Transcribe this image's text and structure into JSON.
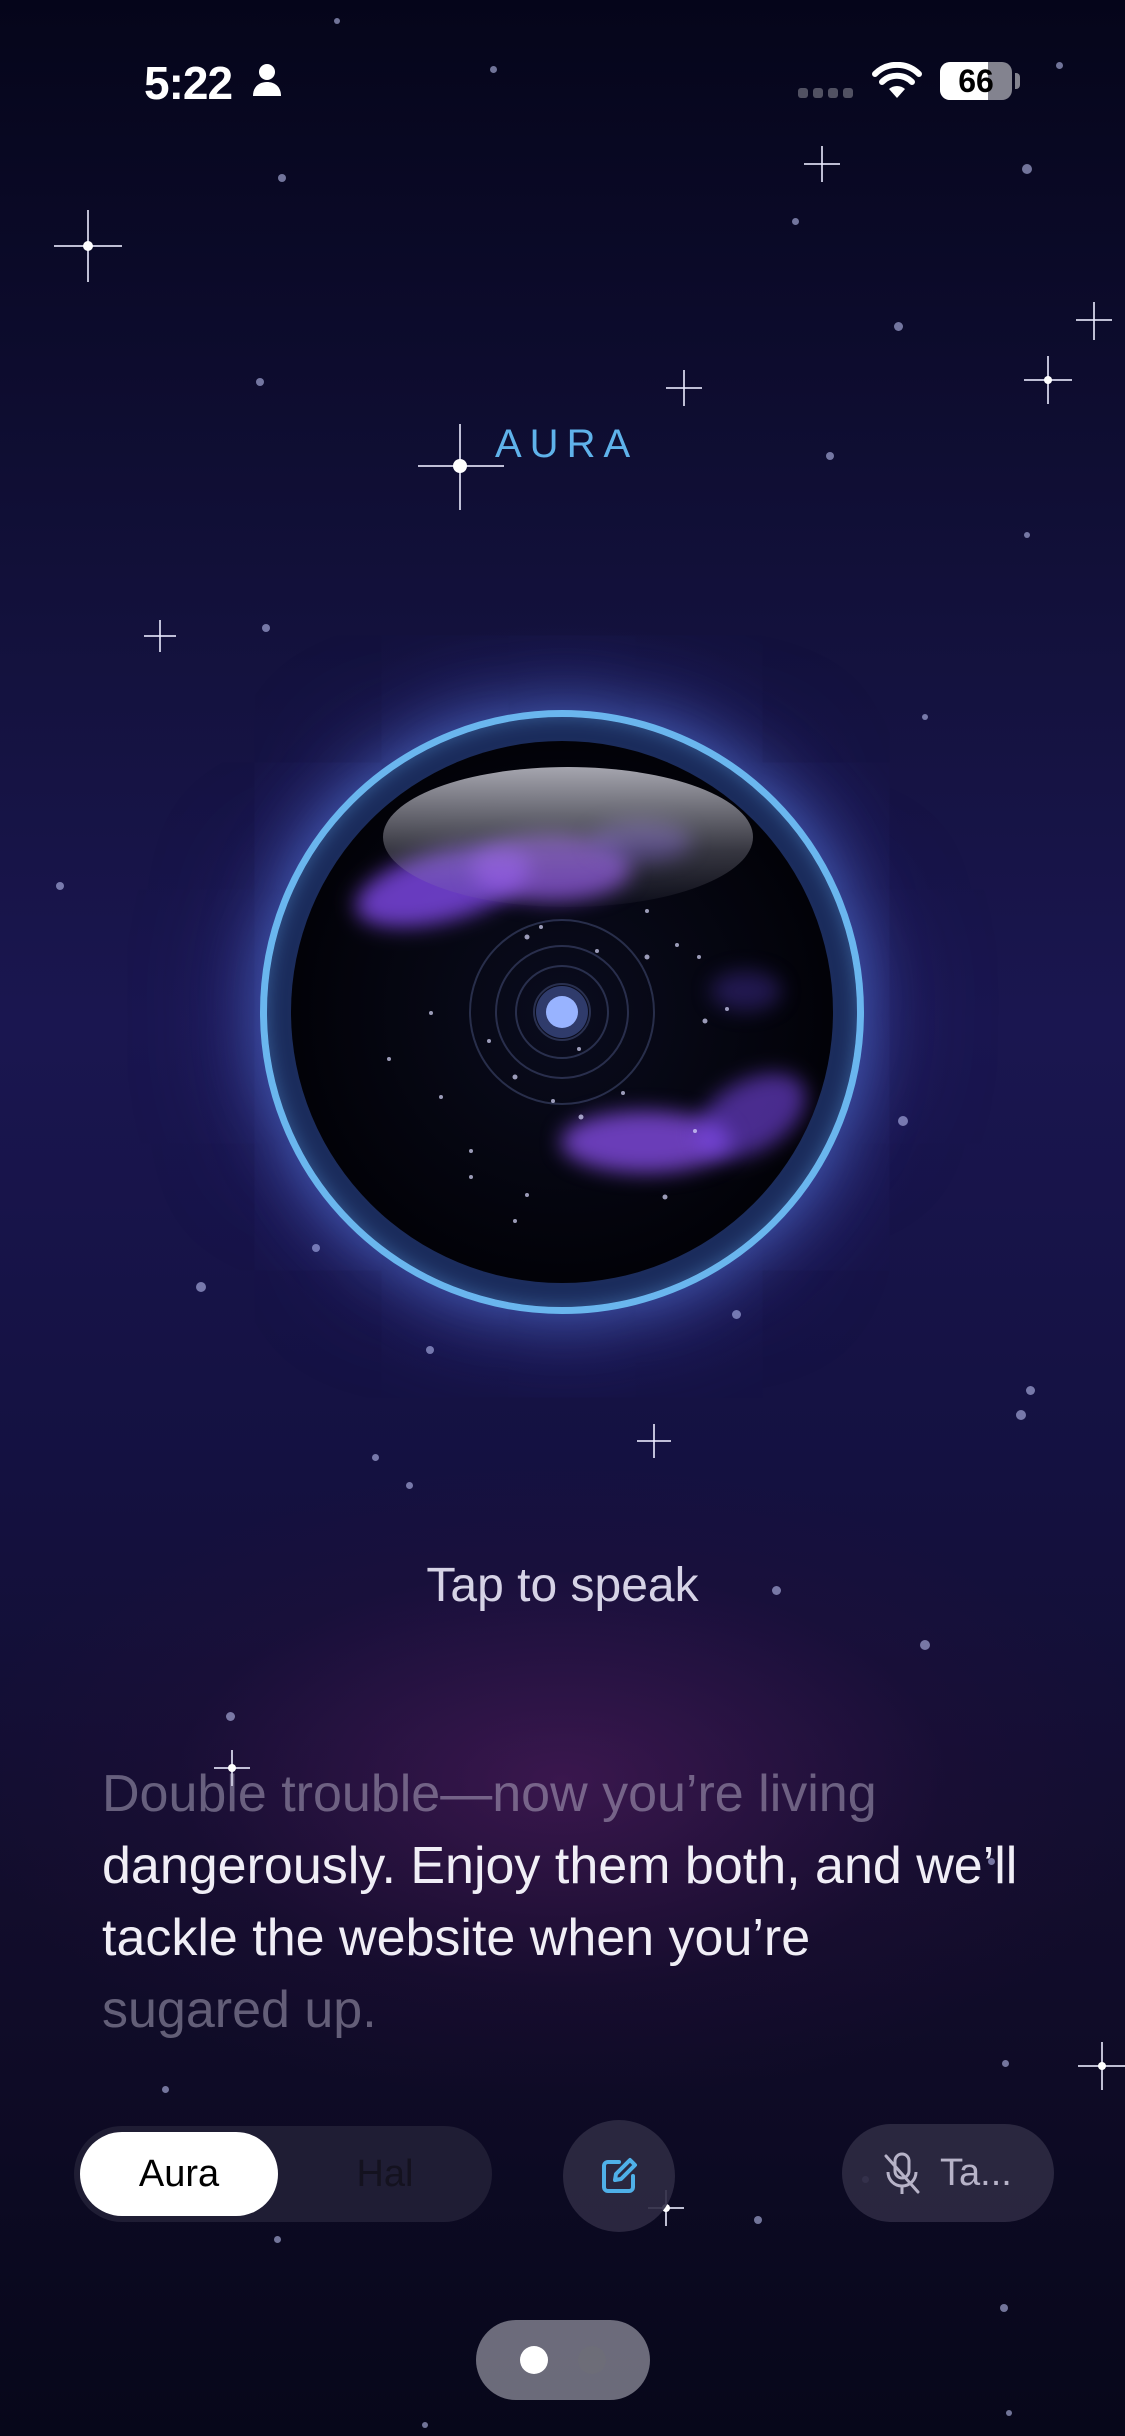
{
  "status_bar": {
    "time": "5:22",
    "battery_level": "66"
  },
  "app": {
    "title": "AURA"
  },
  "orb": {
    "prompt": "Tap to speak"
  },
  "transcript": {
    "faded_line": "Double trouble—now you’re living",
    "main_text": "dangerously. Enjoy them both, and we’ll tackle the website when you’re",
    "faded_tail": "sugared up."
  },
  "controls": {
    "mode_options": [
      "Aura",
      "Hal"
    ],
    "active_mode": "Aura",
    "mic_label": "Ta..."
  },
  "pager": {
    "pages": 2,
    "current": 1
  },
  "colors": {
    "accent": "#6ab6ee",
    "title": "#5fb2ea",
    "nebula": "#8a4dfa"
  }
}
